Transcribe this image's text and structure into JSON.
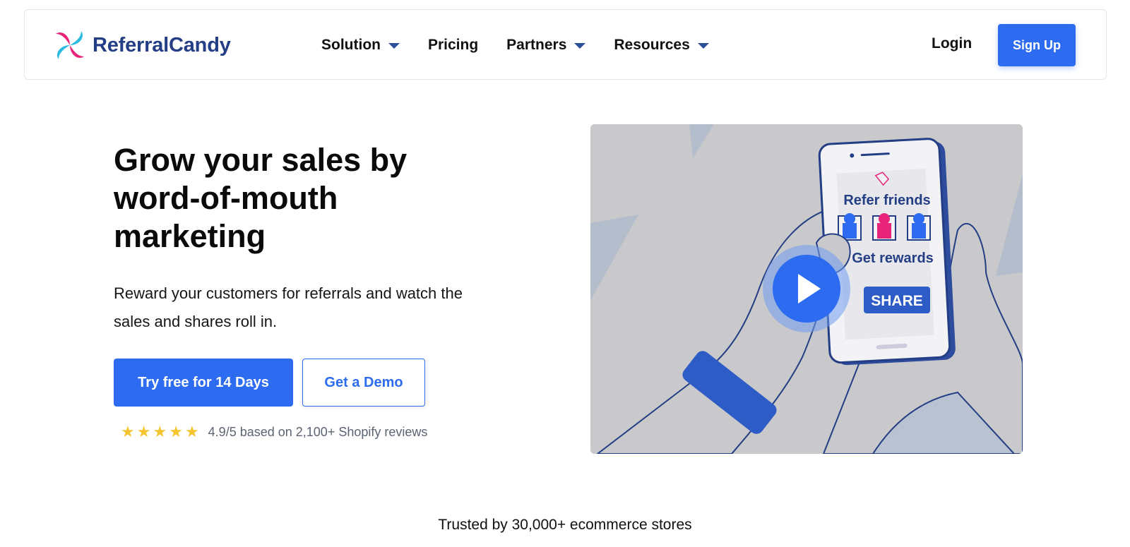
{
  "brand": {
    "name": "ReferralCandy",
    "logo_icon": "pinwheel-logo-icon",
    "colors": {
      "pink": "#e8247a",
      "cyan": "#2bbbe0",
      "navy": "#233e84"
    }
  },
  "nav": {
    "items": [
      {
        "label": "Solution",
        "has_dropdown": true
      },
      {
        "label": "Pricing",
        "has_dropdown": false
      },
      {
        "label": "Partners",
        "has_dropdown": true
      },
      {
        "label": "Resources",
        "has_dropdown": true
      }
    ],
    "login_label": "Login",
    "signup_label": "Sign Up"
  },
  "hero": {
    "title": "Grow your sales by word-of-mouth marketing",
    "subtitle": "Reward your customers for referrals and watch the sales and shares roll in.",
    "primary_cta": "Try free for 14 Days",
    "secondary_cta": "Get a Demo",
    "rating": {
      "stars": 5,
      "text": "4.9/5 based on 2,100+ Shopify reviews"
    }
  },
  "video": {
    "phone_heading": "Refer friends",
    "phone_subheading": "Get rewards",
    "share_label": "SHARE",
    "play_icon": "play-icon"
  },
  "trusted": "Trusted by 30,000+ ecommerce stores",
  "accent_color": "#2d6cf0"
}
